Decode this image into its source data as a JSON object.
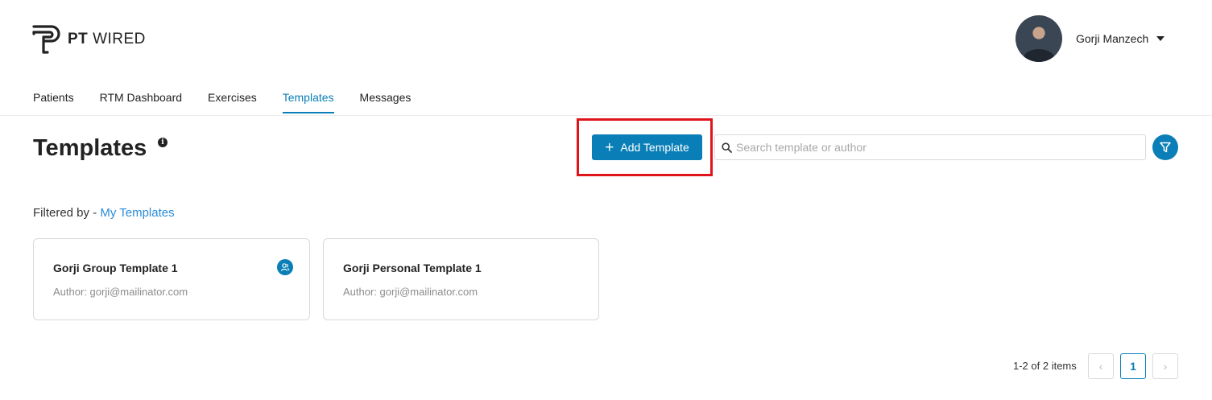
{
  "brand": {
    "name_bold": "PT",
    "name_light": "WIRED"
  },
  "user": {
    "name": "Gorji Manzech"
  },
  "nav": {
    "tabs": [
      {
        "label": "Patients"
      },
      {
        "label": "RTM Dashboard"
      },
      {
        "label": "Exercises"
      },
      {
        "label": "Templates",
        "active": true
      },
      {
        "label": "Messages"
      }
    ]
  },
  "page": {
    "title": "Templates"
  },
  "toolbar": {
    "add_label": "Add Template",
    "search_placeholder": "Search template or author"
  },
  "filter": {
    "prefix": "Filtered by - ",
    "value": "My Templates"
  },
  "cards": [
    {
      "title": "Gorji Group Template 1",
      "author": "Author: gorji@mailinator.com",
      "group": true
    },
    {
      "title": "Gorji Personal Template 1",
      "author": "Author: gorji@mailinator.com",
      "group": false
    }
  ],
  "pagination": {
    "info": "1-2 of 2 items",
    "current": "1",
    "prev": "‹",
    "next": "›"
  },
  "colors": {
    "accent": "#0a7fb7",
    "link": "#2b8bd6",
    "highlight": "#e0151c"
  }
}
